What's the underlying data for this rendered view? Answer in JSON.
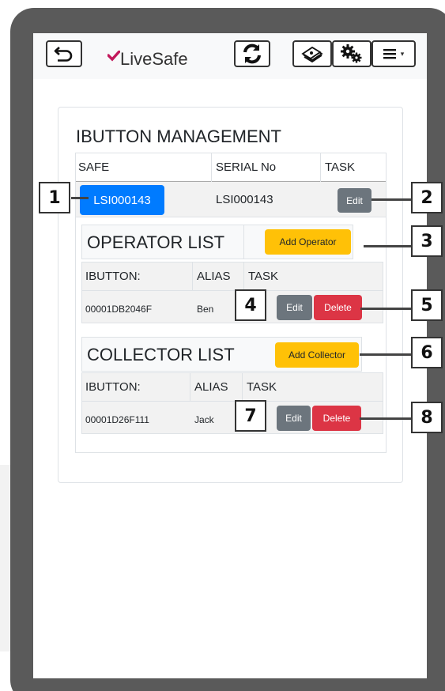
{
  "app": {
    "logo_text": "LiveSafe"
  },
  "header": {
    "icons": [
      "back-icon",
      "refresh-icon",
      "cash-icon",
      "gears-icon",
      "menu-icon"
    ],
    "menu_caret": "▾"
  },
  "card": {
    "title": "IBUTTON MANAGEMENT",
    "columns": [
      "SAFE",
      "SERIAL No",
      "TASK"
    ],
    "safe_button_label": "LSI000143",
    "serial_value": "LSI000143",
    "edit_label": "Edit"
  },
  "operator": {
    "title": "OPERATOR LIST",
    "add_label": "Add Operator",
    "columns": [
      "IBUTTON:",
      "ALIAS",
      "TASK"
    ],
    "rows": [
      {
        "ibutton": "00001DB2046F",
        "alias": "Ben",
        "edit": "Edit",
        "delete": "Delete"
      }
    ]
  },
  "collector": {
    "title": "COLLECTOR LIST",
    "add_label": "Add Collector",
    "columns": [
      "IBUTTON:",
      "ALIAS",
      "TASK"
    ],
    "rows": [
      {
        "ibutton": "00001D26F111",
        "alias": "Jack",
        "edit": "Edit",
        "delete": "Delete"
      }
    ]
  },
  "callouts": [
    "1",
    "2",
    "3",
    "4",
    "5",
    "6",
    "7",
    "8"
  ],
  "colors": {
    "primary": "#007bff",
    "secondary": "#6c757d",
    "danger": "#dc3545",
    "warning": "#ffc107",
    "device_frame": "#5a5a5a"
  }
}
